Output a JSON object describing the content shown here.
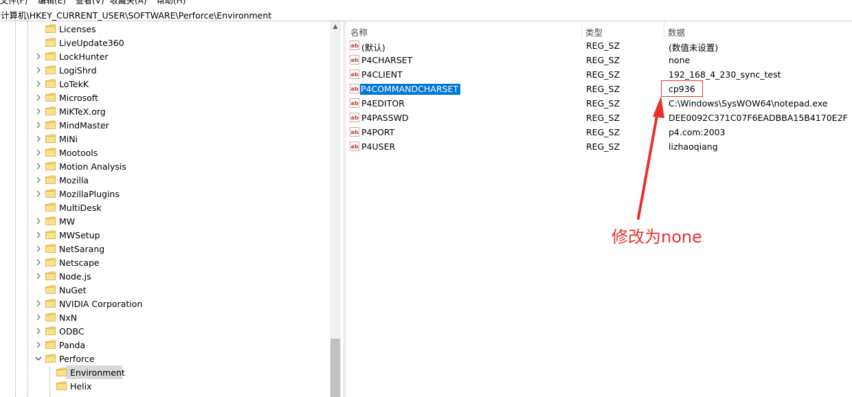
{
  "menubar": [
    "文件(F)",
    "编辑(E)",
    "查看(V)",
    "收藏夹(A)",
    "帮助(H)"
  ],
  "address": "计算机\\HKEY_CURRENT_USER\\SOFTWARE\\Perforce\\Environment",
  "tree": {
    "items": [
      {
        "label": "Licenses",
        "chevron": "none"
      },
      {
        "label": "LiveUpdate360",
        "chevron": "none"
      },
      {
        "label": "LockHunter",
        "chevron": "right"
      },
      {
        "label": "LogiShrd",
        "chevron": "right"
      },
      {
        "label": "LoTekK",
        "chevron": "right"
      },
      {
        "label": "Microsoft",
        "chevron": "right"
      },
      {
        "label": "MiKTeX.org",
        "chevron": "right"
      },
      {
        "label": "MindMaster",
        "chevron": "right"
      },
      {
        "label": "MiNi",
        "chevron": "right"
      },
      {
        "label": "Mootools",
        "chevron": "right"
      },
      {
        "label": "Motion Analysis",
        "chevron": "right"
      },
      {
        "label": "Mozilla",
        "chevron": "right"
      },
      {
        "label": "MozillaPlugins",
        "chevron": "right"
      },
      {
        "label": "MultiDesk",
        "chevron": "none"
      },
      {
        "label": "MW",
        "chevron": "right"
      },
      {
        "label": "MWSetup",
        "chevron": "right"
      },
      {
        "label": "NetSarang",
        "chevron": "right"
      },
      {
        "label": "Netscape",
        "chevron": "right"
      },
      {
        "label": "Node.js",
        "chevron": "right"
      },
      {
        "label": "NuGet",
        "chevron": "none"
      },
      {
        "label": "NVIDIA Corporation",
        "chevron": "right"
      },
      {
        "label": "NxN",
        "chevron": "right"
      },
      {
        "label": "ODBC",
        "chevron": "right"
      },
      {
        "label": "Panda",
        "chevron": "right"
      },
      {
        "label": "Perforce",
        "chevron": "down"
      }
    ],
    "children": [
      {
        "label": "Environment",
        "selected": true
      },
      {
        "label": "Helix",
        "selected": false
      }
    ]
  },
  "values": {
    "columns": {
      "name": "名称",
      "type": "类型",
      "data": "数据"
    },
    "rows": [
      {
        "name": "(默认)",
        "type": "REG_SZ",
        "data": "(数值未设置)",
        "selected": false
      },
      {
        "name": "P4CHARSET",
        "type": "REG_SZ",
        "data": "none",
        "selected": false
      },
      {
        "name": "P4CLIENT",
        "type": "REG_SZ",
        "data": "192_168_4_230_sync_test",
        "selected": false
      },
      {
        "name": "P4COMMANDCHARSET",
        "type": "REG_SZ",
        "data": "cp936",
        "selected": true
      },
      {
        "name": "P4EDITOR",
        "type": "REG_SZ",
        "data": "C:\\Windows\\SysWOW64\\notepad.exe",
        "selected": false
      },
      {
        "name": "P4PASSWD",
        "type": "REG_SZ",
        "data": "DEE0092C371C07F6EADBBA15B4170E2F",
        "selected": false
      },
      {
        "name": "P4PORT",
        "type": "REG_SZ",
        "data": "p4.com:2003",
        "selected": false
      },
      {
        "name": "P4USER",
        "type": "REG_SZ",
        "data": "lizhaoqiang",
        "selected": false
      }
    ]
  },
  "annotation": {
    "text": "修改为none",
    "color": "#e8312f"
  },
  "icons": {
    "folder": "folder-icon",
    "reg_sz": "reg-sz-ab-icon"
  },
  "colors": {
    "selection": "#0078d7",
    "folder": "#f8d775",
    "annotation": "#e8312f"
  }
}
